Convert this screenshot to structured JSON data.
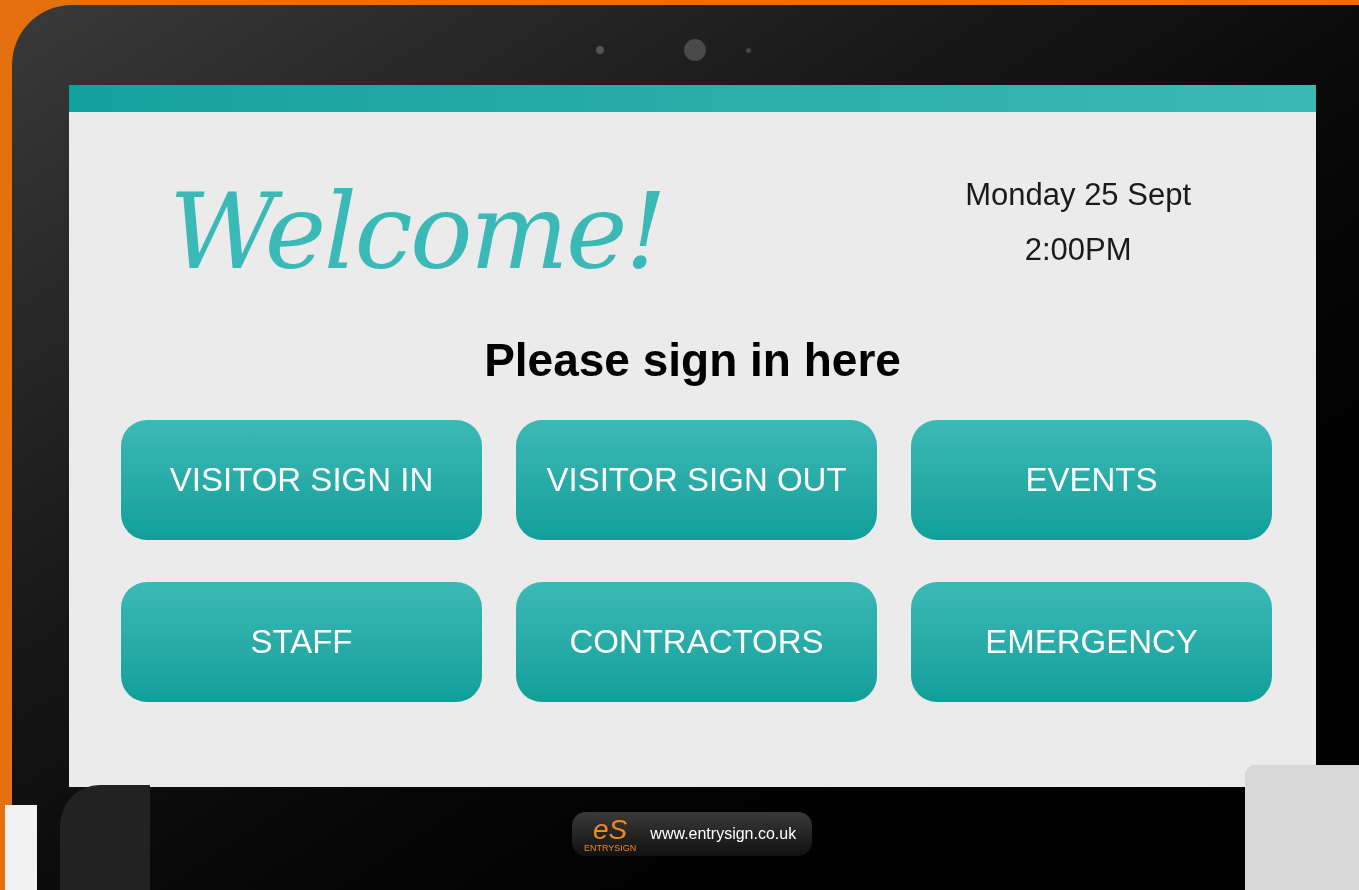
{
  "welcome": "Welcome!",
  "date": "Monday 25 Sept",
  "time": "2:00PM",
  "prompt": "Please sign in here",
  "buttons": [
    {
      "label": "VISITOR SIGN IN"
    },
    {
      "label": "VISITOR SIGN OUT"
    },
    {
      "label": "EVENTS"
    },
    {
      "label": "STAFF"
    },
    {
      "label": "CONTRACTORS"
    },
    {
      "label": "EMERGENCY"
    }
  ],
  "footer": {
    "logo_text": "eS",
    "logo_caption": "ENTRYSIGN",
    "url": "www.entrysign.co.uk"
  }
}
